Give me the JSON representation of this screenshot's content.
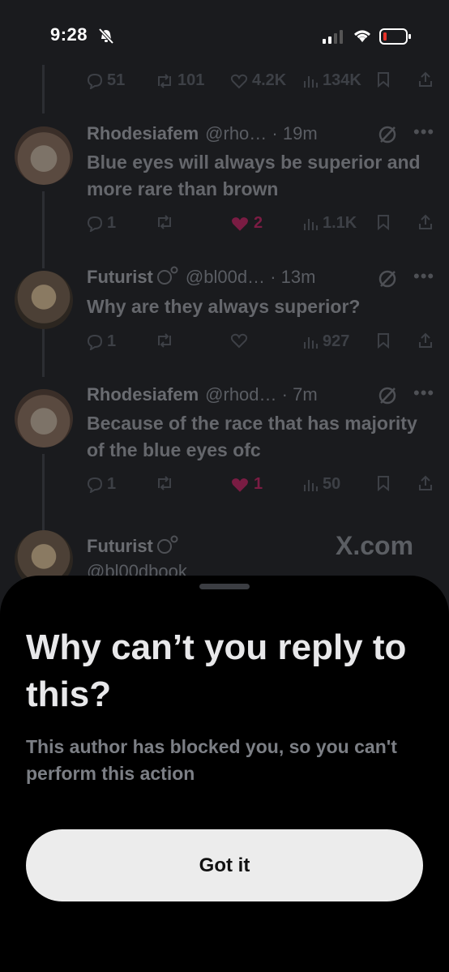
{
  "status_bar": {
    "time": "9:28"
  },
  "top_actions": {
    "replies": "51",
    "retweets": "101",
    "likes": "4.2K",
    "views": "134K"
  },
  "tweets": [
    {
      "name": "Rhodesiafem",
      "handle": "@rho…",
      "time": "· 19m",
      "text": "Blue eyes will always be superior and more rare than brown",
      "replies": "1",
      "retweets": "",
      "likes": "2",
      "views": "1.1K"
    },
    {
      "name": "Futurist",
      "handle": "@bl00d…",
      "time": "· 13m",
      "text": "Why are they always superior?",
      "replies": "1",
      "retweets": "",
      "likes": "",
      "views": "927"
    },
    {
      "name": "Rhodesiafem",
      "handle": "@rhod…",
      "time": "· 7m",
      "text": "Because of the race that has majority of the blue eyes ofc",
      "replies": "1",
      "retweets": "",
      "likes": "1",
      "views": "50"
    },
    {
      "name": "Futurist",
      "handle": "@bl00dbook"
    }
  ],
  "watermark": "X.com",
  "sheet": {
    "title": "Why can’t you reply to this?",
    "description": "This author has blocked you, so you can't perform this action",
    "button_label": "Got it"
  },
  "colors": {
    "like_pink": "#7a1c43",
    "sheet_bg": "#000000",
    "button_bg": "#ececec"
  }
}
